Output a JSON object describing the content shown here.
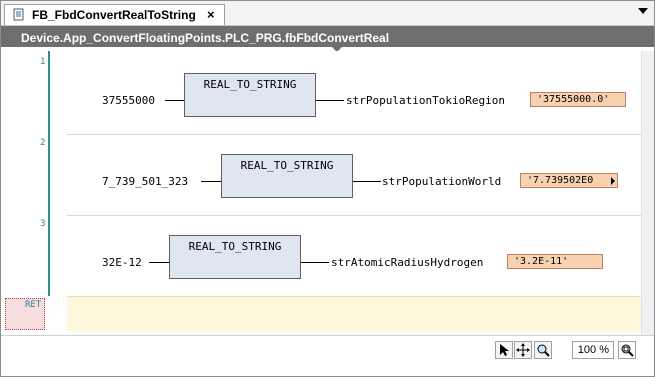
{
  "tab": {
    "title": "FB_FbdConvertRealToString",
    "close": "×"
  },
  "path": "Device.App_ConvertFloatingPoints.PLC_PRG.fbFbdConvertReal",
  "networks": [
    {
      "number": "1",
      "input": "37555000",
      "block": "REAL_TO_STRING",
      "output": "strPopulationTokioRegion",
      "value": "'37555000.0'"
    },
    {
      "number": "2",
      "input": "7_739_501_323",
      "block": "REAL_TO_STRING",
      "output": "strPopulationWorld",
      "value": "'7.739502E0"
    },
    {
      "number": "3",
      "input": "32E-12",
      "block": "REAL_TO_STRING",
      "output": "strAtomicRadiusHydrogen",
      "value": "'3.2E-11'"
    }
  ],
  "ret_label": "RET",
  "status": {
    "zoom": "100 %"
  },
  "icons": [
    "document-icon",
    "close-icon",
    "dropdown-icon",
    "pointer-icon",
    "pan-icon",
    "zoom-icon",
    "zoom-fit-icon"
  ]
}
